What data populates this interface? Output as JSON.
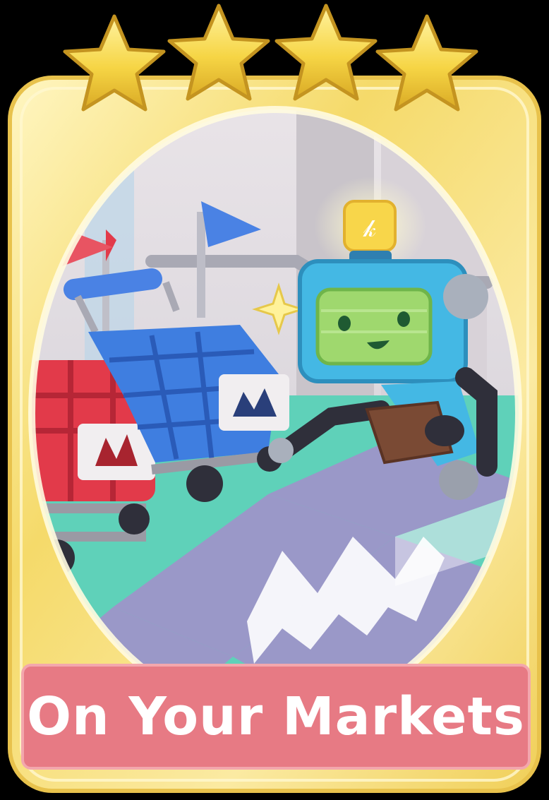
{
  "card": {
    "title": "On Your Markets",
    "stars": 4
  },
  "colors": {
    "frame_gold": "#f7e07a",
    "frame_light": "#fff4b8",
    "star_gold": "#f6d545",
    "banner_pink": "#e77a84",
    "cart_blue": "#3f7ee0",
    "cart_red": "#e23a4a",
    "robot_cyan": "#44b8e4",
    "screen_green": "#9fd86e",
    "floor_teal": "#5fd1b9",
    "floor_lavender": "#9a98c8"
  },
  "icons": [
    "star-icon",
    "flag-icon",
    "sparkle-icon",
    "shopping-cart-icon",
    "robot-icon",
    "clipboard-icon",
    "monopoly-logo-icon"
  ]
}
